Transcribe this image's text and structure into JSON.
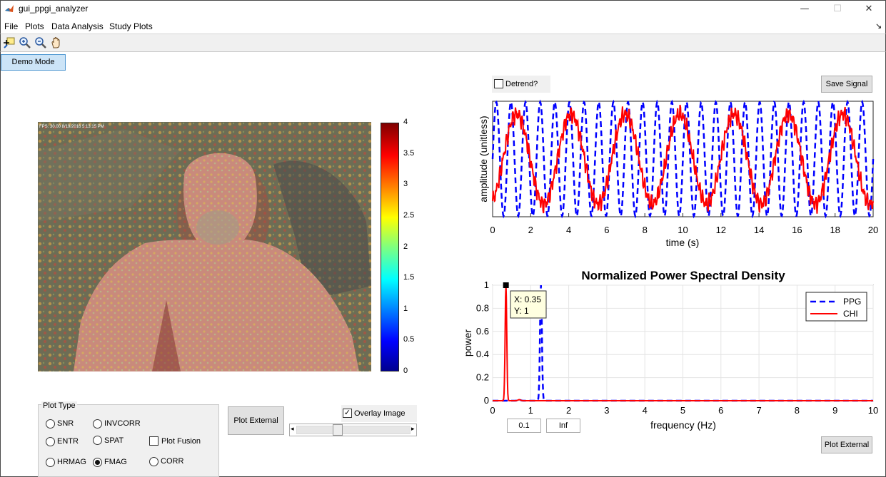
{
  "window": {
    "title": "gui_ppgi_analyzer",
    "minimize_glyph": "—",
    "maximize_glyph": "☐",
    "close_glyph": "✕"
  },
  "menu": {
    "items": [
      "File",
      "Plots",
      "Data Analysis",
      "Study Plots"
    ],
    "dock_glyph": "↘"
  },
  "toolbar": {
    "tools": [
      "data-cursor-icon",
      "zoom-in-icon",
      "zoom-out-icon",
      "pan-hand-icon"
    ]
  },
  "controls": {
    "demo_mode": "Demo Mode",
    "detrend_label": "Detrend?",
    "detrend_checked": false,
    "save_signal": "Save Signal",
    "plot_external": "Plot External",
    "overlay_label": "Overlay Image",
    "overlay_checked": true,
    "slider_arrow_left": "◂",
    "slider_arrow_right": "▸",
    "slider_value_fraction": 0.33,
    "freq_low": "0.1",
    "freq_high": "Inf"
  },
  "plot_type": {
    "title": "Plot Type",
    "options": [
      {
        "label": "SNR",
        "selected": false
      },
      {
        "label": "INVCORR",
        "selected": false
      },
      {
        "label": "ENTR",
        "selected": false
      },
      {
        "label": "SPAT",
        "selected": false
      },
      {
        "label": "HRMAG",
        "selected": false
      },
      {
        "label": "FMAG",
        "selected": true
      },
      {
        "label": "CORR",
        "selected": false
      }
    ],
    "fusion_label": "Plot Fusion",
    "fusion_checked": false
  },
  "image_view": {
    "overlay_text": "FPS: 30.00 8/19/2016 5:13:15 PM",
    "colorbar_ticks": [
      "4",
      "3.5",
      "3",
      "2.5",
      "2",
      "1.5",
      "1",
      "0.5",
      "0"
    ]
  },
  "chart_data": [
    {
      "type": "line",
      "title": "",
      "xlabel": "time (s)",
      "ylabel": "amplitude (unitless)",
      "xlim": [
        0,
        20
      ],
      "xticks": [
        "0",
        "2",
        "4",
        "6",
        "8",
        "10",
        "12",
        "14",
        "16",
        "18",
        "20"
      ],
      "series": [
        {
          "style": "dashed",
          "color": "#0000ff",
          "frequency_hz": 1.3
        },
        {
          "style": "solid",
          "color": "#ff0000",
          "frequency_hz": 0.35
        }
      ]
    },
    {
      "type": "line",
      "title": "Normalized Power Spectral Density",
      "xlabel": "frequency (Hz)",
      "ylabel": "power",
      "xlim": [
        0,
        10
      ],
      "ylim": [
        0,
        1
      ],
      "xticks": [
        "0",
        "1",
        "2",
        "3",
        "4",
        "5",
        "6",
        "7",
        "8",
        "9",
        "10"
      ],
      "yticks": [
        "0",
        "0.2",
        "0.4",
        "0.6",
        "0.8",
        "1"
      ],
      "grid": true,
      "legend_position": "top-right",
      "series": [
        {
          "name": "PPG",
          "style": "dashed",
          "color": "#0000ff",
          "peak_x": 1.27,
          "peak_y": 1
        },
        {
          "name": "CHI",
          "style": "solid",
          "color": "#ff0000",
          "peak_x": 0.35,
          "peak_y": 1
        }
      ],
      "datatip": {
        "x_text": "X: 0.35",
        "y_text": "Y: 1",
        "x": 0.35,
        "y": 1
      }
    }
  ]
}
